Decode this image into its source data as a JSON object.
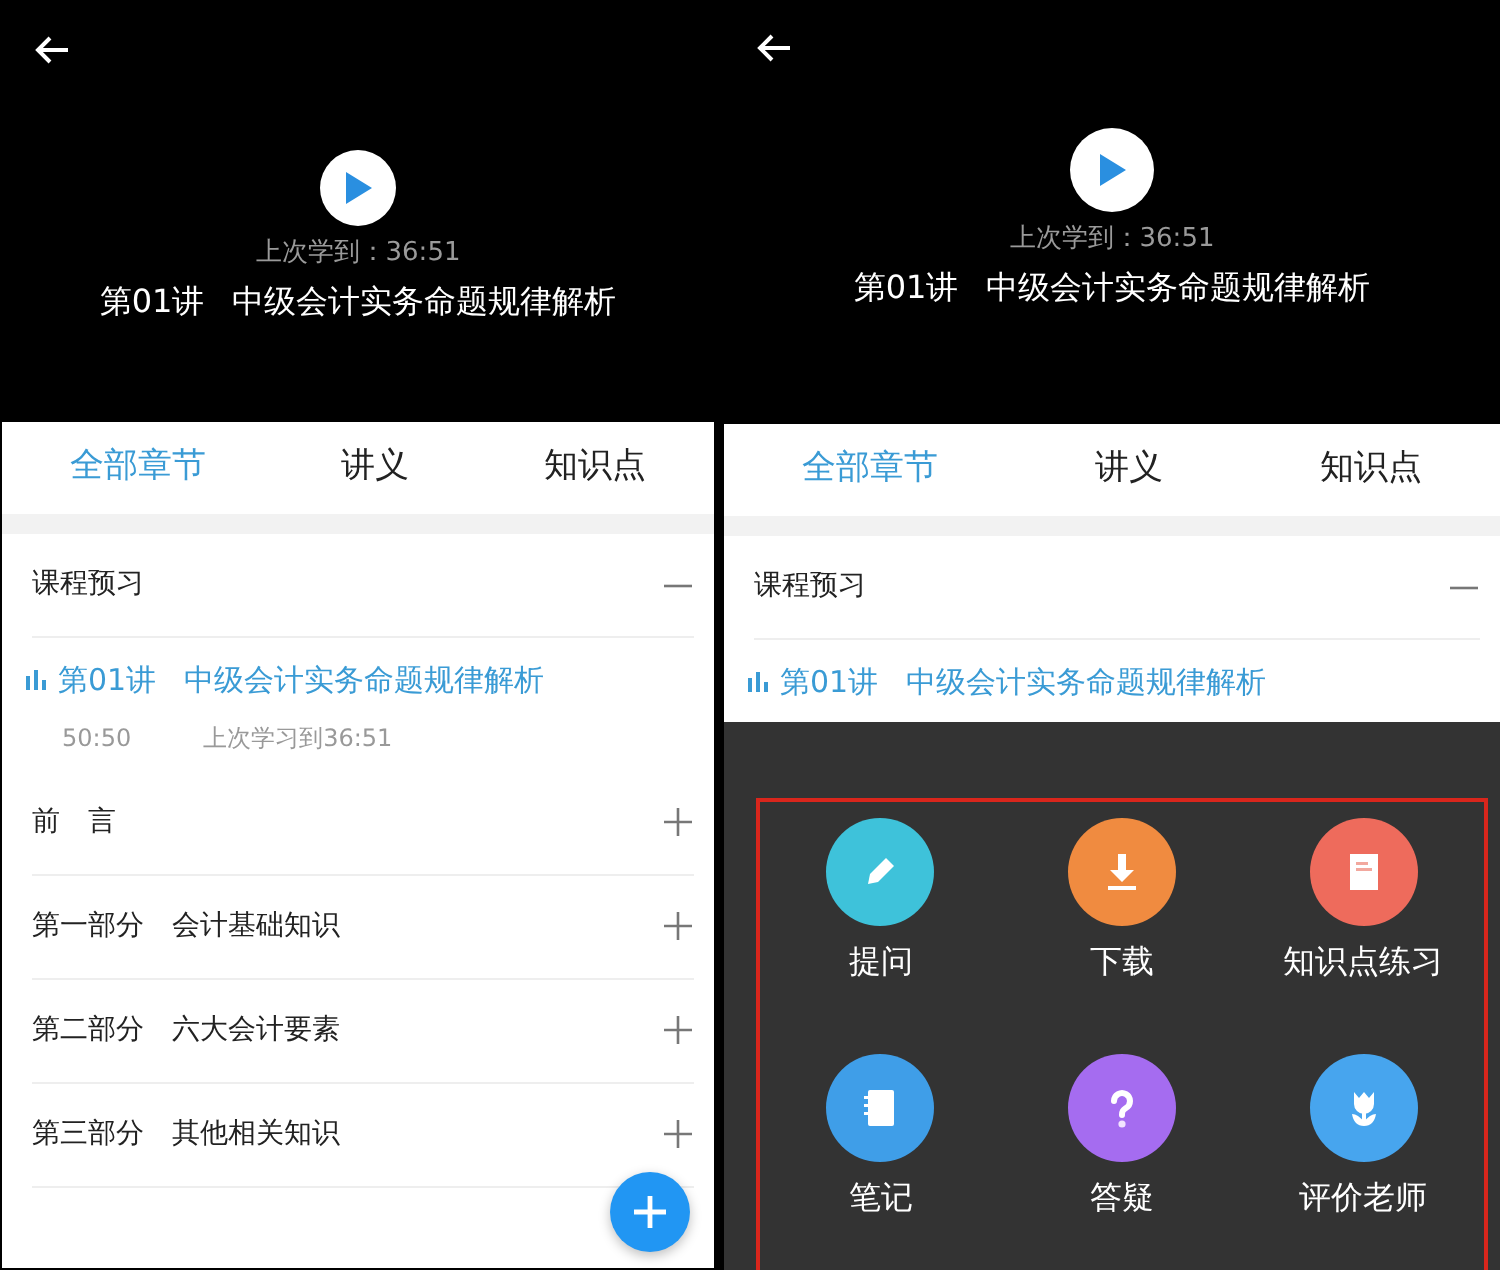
{
  "panels": [
    {
      "player": {
        "resume": "上次学到：36:51",
        "lesson_number": "第01讲",
        "lesson_title": "中级会计实务命题规律解析"
      },
      "tabs": [
        {
          "label": "全部章节",
          "selected": true
        },
        {
          "label": "讲义",
          "selected": false
        },
        {
          "label": "知识点",
          "selected": false
        }
      ],
      "sections": [
        {
          "title": "课程预习",
          "expanded": true,
          "lessons": [
            {
              "number": "第01讲",
              "title": "中级会计实务命题规律解析",
              "duration": "50:50",
              "last_studied": "上次学习到36:51",
              "playing": true
            }
          ]
        },
        {
          "title": "前　言",
          "expanded": false
        },
        {
          "number": "第一部分",
          "title": "会计基础知识",
          "expanded": false
        },
        {
          "number": "第二部分",
          "title": "六大会计要素",
          "expanded": false
        },
        {
          "number": "第三部分",
          "title": "其他相关知识",
          "expanded": false
        }
      ],
      "fab": true
    },
    {
      "player": {
        "resume": "上次学到：36:51",
        "lesson_number": "第01讲",
        "lesson_title": "中级会计实务命题规律解析"
      },
      "tabs": [
        {
          "label": "全部章节",
          "selected": true
        },
        {
          "label": "讲义",
          "selected": false
        },
        {
          "label": "知识点",
          "selected": false
        }
      ],
      "sections": [
        {
          "title": "课程预习",
          "expanded": true,
          "lessons": [
            {
              "number": "第01讲",
              "title": "中级会计实务命题规律解析",
              "playing": true
            }
          ]
        }
      ],
      "action_menu": {
        "highlighted": true,
        "items": [
          {
            "label": "提问",
            "kind": "pencil",
            "color": "#3ec2da"
          },
          {
            "label": "下载",
            "kind": "download",
            "color": "#f08b40"
          },
          {
            "label": "知识点练习",
            "kind": "document",
            "color": "#ee6b5c"
          },
          {
            "label": "笔记",
            "kind": "notebook",
            "color": "#3f9ee8"
          },
          {
            "label": "答疑",
            "kind": "question",
            "color": "#a56cf0"
          },
          {
            "label": "评价老师",
            "kind": "flower",
            "color": "#47a5ee"
          }
        ]
      }
    }
  ]
}
